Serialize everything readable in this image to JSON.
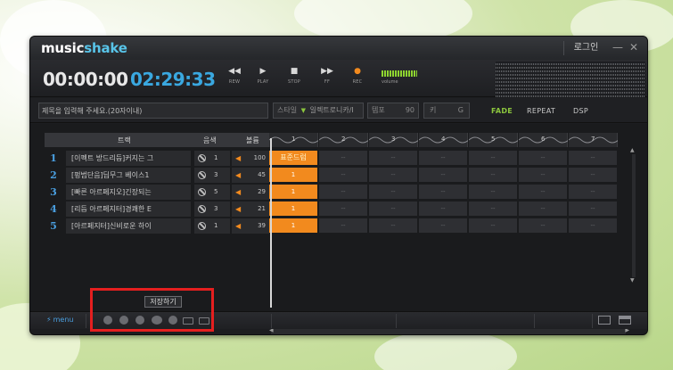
{
  "app": {
    "logo_main": "music",
    "logo_accent": "shake",
    "login_label": "로그인",
    "minimize_label": "—",
    "close_label": "✕"
  },
  "transport": {
    "current_time": "00:00:00",
    "total_time": "02:29:33",
    "buttons": [
      {
        "label": "REW",
        "icon": "◀◀"
      },
      {
        "label": "PLAY",
        "icon": "▶"
      },
      {
        "label": "STOP",
        "icon": "■"
      },
      {
        "label": "FF",
        "icon": "▶▶"
      },
      {
        "label": "REC",
        "icon": "●"
      }
    ],
    "volume_label": "volume"
  },
  "info": {
    "title_placeholder": "제목을 입력해 주세요.(20자이내)",
    "style_label": "스타일",
    "style_value": "일렉트로니카/I",
    "tempo_label": "템포",
    "tempo_value": "90",
    "key_label": "키",
    "key_value": "G",
    "fade_label": "FADE",
    "repeat_label": "REPEAT",
    "dsp_label": "DSP"
  },
  "track_header": {
    "track": "트랙",
    "tone": "음색",
    "volume": "볼륨"
  },
  "tracks": [
    {
      "num": "1",
      "name": "[이펙트 방드리듬]커지는 그",
      "tone": "1",
      "volume": "100"
    },
    {
      "num": "2",
      "name": "[펑범단음]딥무그 베이스1",
      "tone": "3",
      "volume": "45"
    },
    {
      "num": "3",
      "name": "[빠른 아르페지오]긴장되는",
      "tone": "5",
      "volume": "29"
    },
    {
      "num": "4",
      "name": "[리듬 아르페지터]경쾌한 E",
      "tone": "3",
      "volume": "21"
    },
    {
      "num": "5",
      "name": "[아르페지터]신비로운 하이",
      "tone": "1",
      "volume": "39"
    }
  ],
  "bars": [
    "1",
    "2",
    "3",
    "4",
    "5",
    "6",
    "7"
  ],
  "grid": {
    "first_cell_label": "표준드럼",
    "active_label": "1",
    "empty_label": "--"
  },
  "bottom": {
    "save_label": "저장하기",
    "menu_label": "menu",
    "menu_icon": "⚡"
  },
  "colors": {
    "accent_orange": "#f28a1e",
    "accent_blue": "#3aa8e0",
    "accent_green": "#8cc63e",
    "highlight_red": "#e51f1f"
  }
}
